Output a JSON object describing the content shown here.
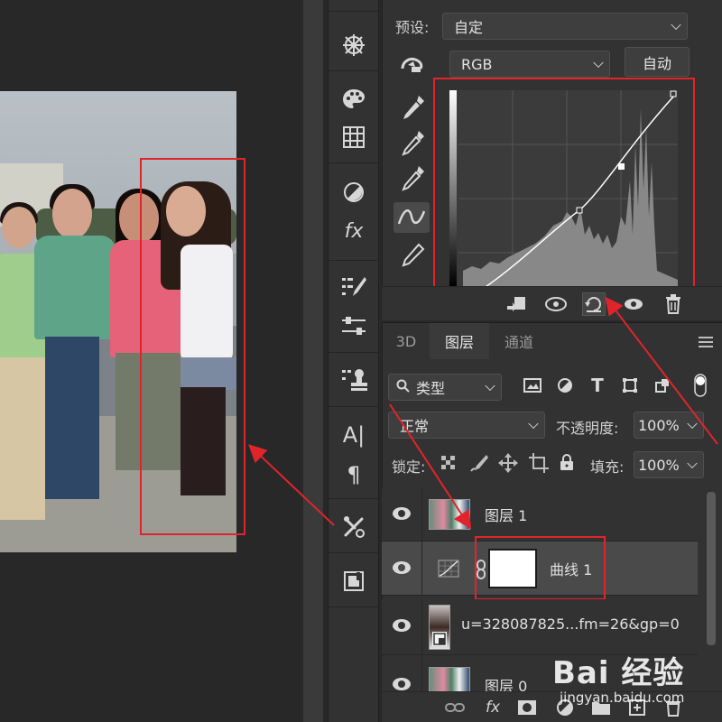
{
  "canvas": {
    "accent_red": "#e0242c"
  },
  "tools": {
    "items": [
      "compass-wheel-icon",
      "swirl-icon",
      "palette-icon",
      "grid-icon",
      "adjustment-circle-icon",
      "fx-icon",
      "brush-list-icon",
      "sliders-icon",
      "stamp-icon",
      "character-icon",
      "paragraph-icon",
      "tools-x-icon",
      "image-book-icon"
    ],
    "fx_glyph": "fx",
    "a_glyph": "A|",
    "para_glyph": "¶"
  },
  "properties": {
    "preset_label": "预设:",
    "preset_value": "自定",
    "channel_value": "RGB",
    "auto_button": "自动"
  },
  "layers_panel": {
    "tabs": [
      "3D",
      "图层",
      "通道"
    ],
    "active_tab": "图层",
    "filter_label": "类型",
    "blend_mode": "正常",
    "opacity_label": "不透明度:",
    "opacity_value": "100%",
    "lock_label": "锁定:",
    "fill_label": "填充:",
    "fill_value": "100%",
    "layers": [
      {
        "name": "图层 1",
        "kind": "image",
        "selected": false
      },
      {
        "name": "曲线 1",
        "kind": "curves-adjustment",
        "selected": true
      },
      {
        "name": "u=328087825...fm=26&gp=0",
        "kind": "smart-object",
        "selected": false
      },
      {
        "name": "图层 0",
        "kind": "image",
        "selected": false
      }
    ],
    "bottom_fx": "fx"
  },
  "watermark": {
    "text": "Bai 经验",
    "url": "jingyan.baidu.com"
  }
}
